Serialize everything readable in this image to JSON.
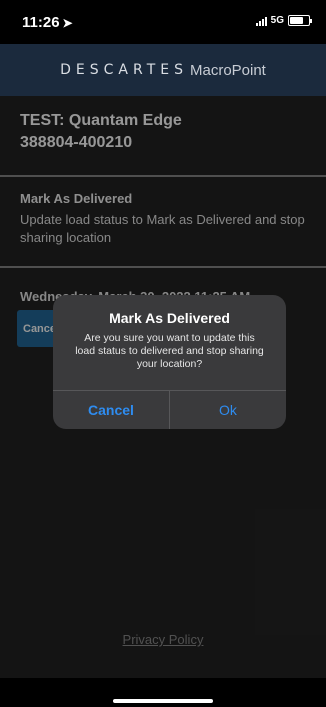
{
  "status_bar": {
    "time": "11:26",
    "network": "5G"
  },
  "brand": {
    "name": "DESCARTES",
    "product": "MacroPoint"
  },
  "load": {
    "title_line1": "TEST: Quantam Edge",
    "title_line2": "388804-400210"
  },
  "action": {
    "title": "Mark As Delivered",
    "description": "Update load status to Mark as Delivered and stop sharing location"
  },
  "timestamp": "Wednesday, March 30, 2022 11:25 AM",
  "background_cancel_label": "Cancel",
  "dialog": {
    "title": "Mark As Delivered",
    "message": "Are you sure you want to update this load status to delivered and stop sharing your location?",
    "cancel_label": "Cancel",
    "ok_label": "Ok"
  },
  "footer": {
    "privacy_link": "Privacy Policy"
  },
  "colors": {
    "accent": "#2e8cf0",
    "header_bg": "#1b2a3d",
    "content_bg": "#202020",
    "button_blue": "#1f5f8a"
  },
  "icons": {
    "location": "location-arrow-icon",
    "signal": "signal-icon",
    "battery": "battery-icon"
  }
}
